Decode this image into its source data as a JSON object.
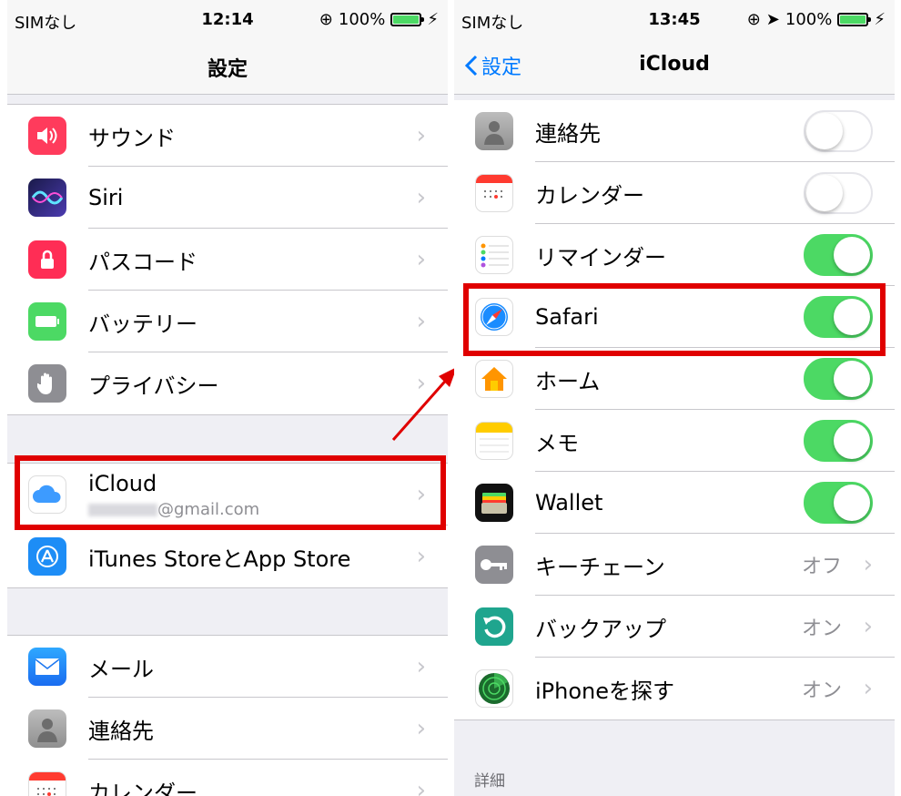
{
  "left": {
    "status": {
      "carrier": "SIMなし",
      "time": "12:14",
      "battery": "100%"
    },
    "nav_title": "設定",
    "rows": [
      {
        "label": "サウンド",
        "icon": "sound-icon",
        "color": "#ff3b5c"
      },
      {
        "label": "Siri",
        "icon": "siri-icon",
        "color": "#2c2c6e"
      },
      {
        "label": "パスコード",
        "icon": "lock-icon",
        "color": "#ff2d55"
      },
      {
        "label": "バッテリー",
        "icon": "battery-icon",
        "color": "#4cd964"
      },
      {
        "label": "プライバシー",
        "icon": "hand-icon",
        "color": "#8e8e93"
      },
      {
        "label": "iCloud",
        "sub": "@gmail.com",
        "icon": "icloud-icon",
        "color": "#ffffff"
      },
      {
        "label": "iTunes StoreとApp Store",
        "icon": "app-store-icon",
        "color": "#1d8df6"
      },
      {
        "label": "メール",
        "icon": "mail-icon",
        "color": "#1e90ff"
      },
      {
        "label": "連絡先",
        "icon": "contacts-icon",
        "color": "#9b9b9b"
      },
      {
        "label": "カレンダー",
        "icon": "calendar-icon",
        "color": "#ffffff"
      }
    ]
  },
  "right": {
    "status": {
      "carrier": "SIMなし",
      "time": "13:45",
      "battery": "100%"
    },
    "nav_title": "iCloud",
    "back_label": "設定",
    "rows": [
      {
        "label": "連絡先",
        "icon": "contacts-icon",
        "toggle": false
      },
      {
        "label": "カレンダー",
        "icon": "calendar-icon",
        "toggle": false
      },
      {
        "label": "リマインダー",
        "icon": "reminders-icon",
        "toggle": true
      },
      {
        "label": "Safari",
        "icon": "safari-icon",
        "toggle": true
      },
      {
        "label": "ホーム",
        "icon": "home-icon",
        "toggle": true
      },
      {
        "label": "メモ",
        "icon": "notes-icon",
        "toggle": true
      },
      {
        "label": "Wallet",
        "icon": "wallet-icon",
        "toggle": true
      },
      {
        "label": "キーチェーン",
        "icon": "key-icon",
        "value": "オフ"
      },
      {
        "label": "バックアップ",
        "icon": "backup-icon",
        "value": "オン"
      },
      {
        "label": "iPhoneを探す",
        "icon": "find-iphone-icon",
        "value": "オン"
      }
    ],
    "footer_label": "詳細"
  },
  "colors": {
    "highlight": "#e00000",
    "toggle_on": "#4cd964",
    "ios_blue": "#007aff"
  }
}
